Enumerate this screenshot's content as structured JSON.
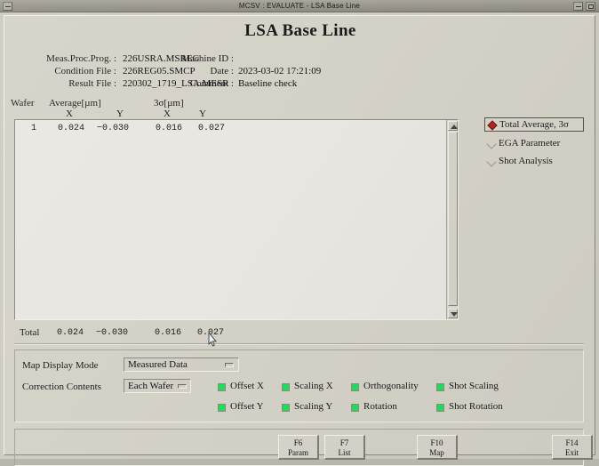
{
  "window": {
    "title": "MCSV : EVALUATE - LSA Base Line",
    "sys_menu_icon": "window-menu-icon",
    "minimize_icon": "minimize-icon",
    "maximize_icon": "maximize-icon"
  },
  "page": {
    "heading": "LSA Base Line"
  },
  "header_info": {
    "left": [
      {
        "label": "Meas.Proc.Prog. :",
        "value": "226USRA.MSREG"
      },
      {
        "label": "Condition File :",
        "value": "226REG05.SMCP"
      },
      {
        "label": "Result File :",
        "value": "220302_1719_LSA.MESR"
      }
    ],
    "right": [
      {
        "label": "Machine ID :",
        "value": ""
      },
      {
        "label": "Date :",
        "value": "2023-03-02 17:21:09"
      },
      {
        "label": "Comment :",
        "value": "Baseline check"
      }
    ]
  },
  "table": {
    "headers": {
      "wafer": "Wafer",
      "average_group": "Average[µm]",
      "sigma_group": "3σ[µm]",
      "average_x": "X",
      "average_y": "Y",
      "sigma_x": "X",
      "sigma_y": "Y"
    },
    "rows": [
      {
        "wafer": "1",
        "average_x": "0.024",
        "average_y": "−0.030",
        "sigma_x": "0.016",
        "sigma_y": "0.027"
      }
    ],
    "total": {
      "label": "Total",
      "average_x": "0.024",
      "average_y": "−0.030",
      "sigma_x": "0.016",
      "sigma_y": "0.027"
    }
  },
  "view_modes": {
    "selected_index": 0,
    "items": [
      {
        "label": "Total Average, 3σ"
      },
      {
        "label": "EGA Parameter"
      },
      {
        "label": "Shot Analysis"
      }
    ]
  },
  "settings": {
    "map_display_mode": {
      "label": "Map Display Mode",
      "value": "Measured Data"
    },
    "correction_contents": {
      "label": "Correction Contents",
      "value": "Each Wafer"
    },
    "correction_checkboxes": [
      {
        "label": "Offset X",
        "checked": true
      },
      {
        "label": "Scaling X",
        "checked": true
      },
      {
        "label": "Orthogonality",
        "checked": true
      },
      {
        "label": "Shot Scaling",
        "checked": true
      },
      {
        "label": "Offset Y",
        "checked": true
      },
      {
        "label": "Scaling Y",
        "checked": true
      },
      {
        "label": "Rotation",
        "checked": true
      },
      {
        "label": "Shot Rotation",
        "checked": true
      }
    ],
    "checkbox_color": "#1ee05a"
  },
  "function_keys": [
    {
      "key": "F6",
      "name": "Param"
    },
    {
      "key": "F7",
      "name": "List"
    },
    {
      "key": "F10",
      "name": "Map"
    },
    {
      "key": "F14",
      "name": "Exit"
    }
  ],
  "cursor": {
    "icon": "pointer-cursor"
  }
}
